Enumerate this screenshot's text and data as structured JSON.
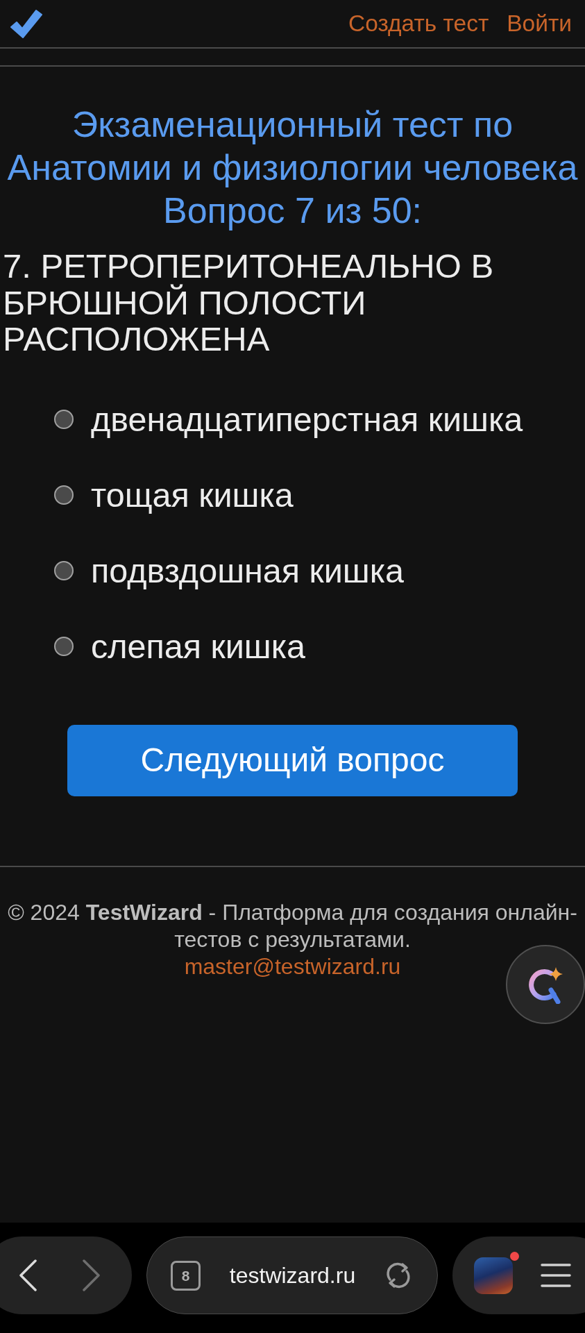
{
  "header": {
    "nav_links": [
      {
        "label": "Создать тест"
      },
      {
        "label": "Войти"
      }
    ]
  },
  "test": {
    "title": "Экзаменационный тест по Анатомии и физиологии человека",
    "counter": "Вопрос 7 из 50:"
  },
  "question": {
    "text": "7. РЕТРОПЕРИТОНЕАЛЬНО В БРЮШНОЙ ПОЛОСТИ РАСПОЛОЖЕНА",
    "options": [
      {
        "label": "двенадцатиперстная кишка",
        "selected": false
      },
      {
        "label": "тощая кишка",
        "selected": false
      },
      {
        "label": "подвздошная кишка",
        "selected": false
      },
      {
        "label": "слепая кишка",
        "selected": false
      }
    ]
  },
  "next_button": {
    "label": "Следующий вопрос"
  },
  "footer": {
    "text": "© 2024 **TestWizard** - Платформа для создания онлайн-тестов с результатами.",
    "email": "master@testwizard.ru"
  },
  "browser_bar": {
    "nav_buttons": [
      {
        "kind": "back",
        "disabled": false
      },
      {
        "kind": "forward",
        "disabled": true
      }
    ],
    "tab_count": "8",
    "url": "testwizard.ru"
  }
}
